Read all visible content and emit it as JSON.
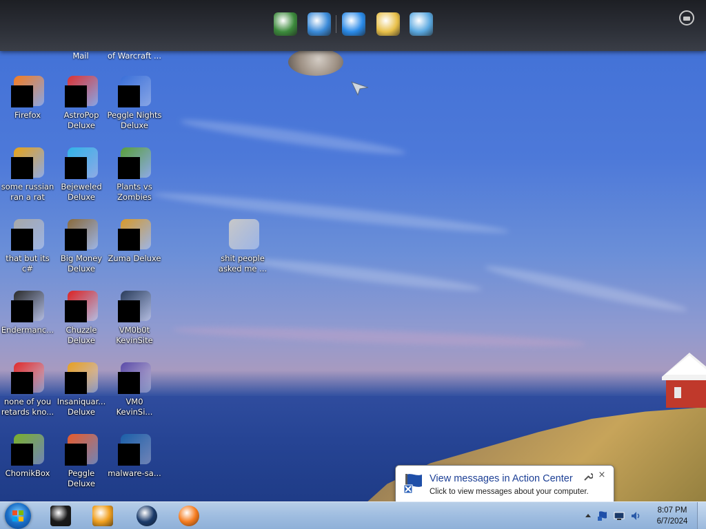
{
  "desktop_icons": [
    {
      "label": "Firefox",
      "icon": "firefox-icon",
      "color": "#f57c1f"
    },
    {
      "label": "AstroPop\nDeluxe",
      "icon": "astropop-icon",
      "color": "#d33"
    },
    {
      "label": "Peggle Nights\nDeluxe",
      "icon": "peggle-nights-icon",
      "color": "#3a6fd8"
    },
    {
      "label": "some russian\nran a rat",
      "icon": "script-file-icon",
      "color": "#e8a316"
    },
    {
      "label": "Bejeweled\nDeluxe",
      "icon": "bejeweled-icon",
      "color": "#31b4e8"
    },
    {
      "label": "Plants vs\nZombies",
      "icon": "plants-vs-zombies-icon",
      "color": "#5aa03a"
    },
    {
      "label": "that but its c#",
      "icon": "copy-files-icon",
      "color": "#a8a8a8"
    },
    {
      "label": "Big Money\nDeluxe",
      "icon": "big-money-icon",
      "color": "#8a6a3a"
    },
    {
      "label": "Zuma Deluxe",
      "icon": "zuma-icon",
      "color": "#d89a2a"
    },
    {
      "label": "Endermanc...",
      "icon": "terminal-icon",
      "color": "#2a2a2a"
    },
    {
      "label": "Chuzzle\nDeluxe",
      "icon": "chuzzle-icon",
      "color": "#d22"
    },
    {
      "label": "VM0b0t\nKevinSite",
      "icon": "monitor-icon",
      "color": "#2a3c5a"
    },
    {
      "label": "none of you\nretards kno...",
      "icon": "opera-icon",
      "color": "#e02a2a"
    },
    {
      "label": "Insaniquar...\nDeluxe",
      "icon": "insaniquarium-icon",
      "color": "#e8a020"
    },
    {
      "label": "VM0\nKevinSi...",
      "icon": "vm-icon",
      "color": "#5a4aa8"
    },
    {
      "label": "ChomikBox",
      "icon": "chomikbox-icon",
      "color": "#7ab02a"
    },
    {
      "label": "Peggle Deluxe",
      "icon": "peggle-icon",
      "color": "#e85a2a"
    },
    {
      "label": "malware-sa...",
      "icon": "phone-app-icon",
      "color": "#1a5fa8"
    },
    {
      "label": "shit people\nasked me ...",
      "icon": "folder-icon",
      "color": "#c8c8c8"
    }
  ],
  "partial_top_icons": [
    {
      "label": "Mail"
    },
    {
      "label": "of Warcraft ..."
    }
  ],
  "dock_icons": [
    {
      "name": "task-manager-icon",
      "color": "#3c8a3c"
    },
    {
      "name": "globe-download-icon",
      "color": "#3a8ad8"
    },
    {
      "name": "internet-explorer-icon",
      "color": "#2a8ae8"
    },
    {
      "name": "mail-envelope-icon",
      "color": "#e8c04a"
    },
    {
      "name": "users-group-icon",
      "color": "#5aa8e0"
    }
  ],
  "notification": {
    "title": "View messages in Action Center",
    "text": "Click to view messages about your computer.",
    "close": "×"
  },
  "taskbar": {
    "buttons": [
      {
        "name": "taskbar-app-black-window",
        "color": "#1a1a1a"
      },
      {
        "name": "taskbar-media-player",
        "color": "#f0a020"
      },
      {
        "name": "taskbar-app-dark-circle",
        "color": "#1a3a6a"
      },
      {
        "name": "taskbar-firefox",
        "color": "#f57c1f"
      }
    ],
    "time": "8:07 PM",
    "date": "6/7/2024"
  }
}
